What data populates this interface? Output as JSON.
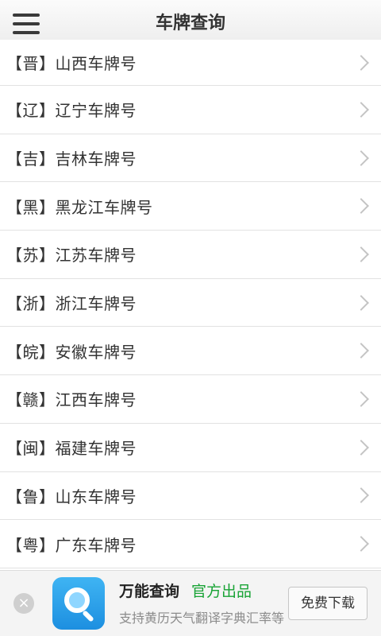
{
  "header": {
    "title": "车牌查询",
    "menu_icon": "hamburger-menu-icon"
  },
  "list": {
    "items": [
      {
        "label": "【晋】山西车牌号"
      },
      {
        "label": "【辽】辽宁车牌号"
      },
      {
        "label": "【吉】吉林车牌号"
      },
      {
        "label": "【黑】黑龙江车牌号"
      },
      {
        "label": "【苏】江苏车牌号"
      },
      {
        "label": "【浙】浙江车牌号"
      },
      {
        "label": "【皖】安徽车牌号"
      },
      {
        "label": "【赣】江西车牌号"
      },
      {
        "label": "【闽】福建车牌号"
      },
      {
        "label": "【鲁】山东车牌号"
      },
      {
        "label": "【粤】广东车牌号"
      }
    ],
    "row_icon": "chevron-right-icon"
  },
  "ad": {
    "close_glyph": "×",
    "app_name": "万能查询",
    "official_label": "官方出品",
    "description": "支持黄历天气翻译字典汇率等",
    "download_label": "免费下载",
    "official_color": "#18a335",
    "icon_color": "#2a9fe9"
  }
}
